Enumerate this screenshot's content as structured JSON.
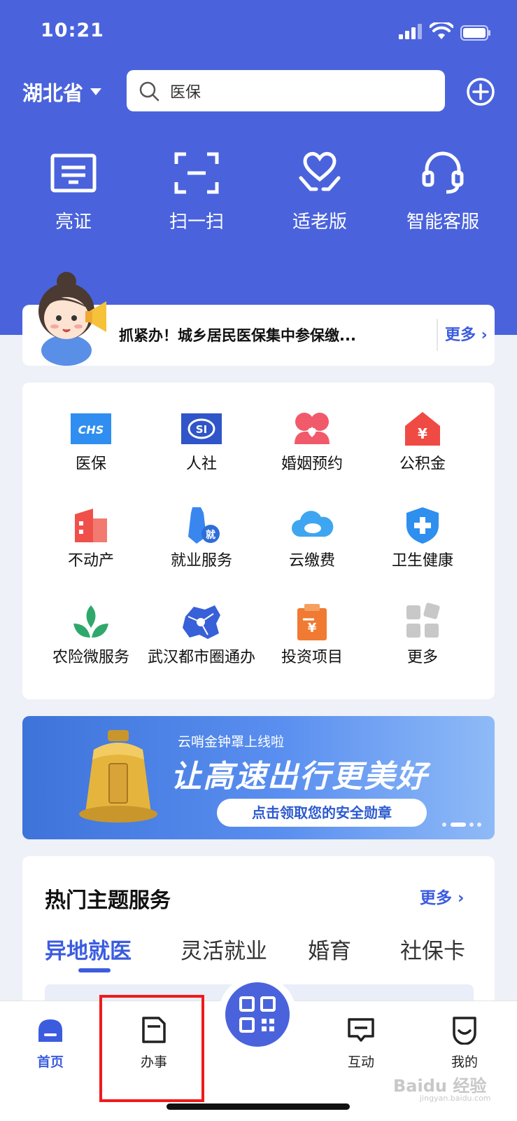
{
  "status_bar": {
    "time": "10:21"
  },
  "header": {
    "region": "湖北省",
    "search_placeholder": "医保"
  },
  "quick_actions": [
    {
      "label": "亮证",
      "icon": "id-card-icon"
    },
    {
      "label": "扫一扫",
      "icon": "scan-frame-icon"
    },
    {
      "label": "适老版",
      "icon": "heart-hands-icon"
    },
    {
      "label": "智能客服",
      "icon": "headset-icon"
    }
  ],
  "notice": {
    "text": "抓紧办！城乡居民医保集中参保缴...",
    "more": "更多 ›"
  },
  "services": [
    {
      "label": "医保",
      "icon": "chs-logo-icon",
      "color": "#2f8ef0"
    },
    {
      "label": "人社",
      "icon": "si-logo-icon",
      "color": "#2f55c8"
    },
    {
      "label": "婚姻预约",
      "icon": "couple-heart-icon",
      "color": "#f05a6a"
    },
    {
      "label": "公积金",
      "icon": "house-yuan-icon",
      "color": "#f04a45"
    },
    {
      "label": "不动产",
      "icon": "building-icon",
      "color": "#f0504a"
    },
    {
      "label": "就业服务",
      "icon": "tie-icon",
      "color": "#3a86ef"
    },
    {
      "label": "云缴费",
      "icon": "cloud-icon",
      "color": "#3ea6f0"
    },
    {
      "label": "卫生健康",
      "icon": "shield-cross-icon",
      "color": "#2e8fef"
    },
    {
      "label": "农险微服务",
      "icon": "sprout-icon",
      "color": "#2fa96b"
    },
    {
      "label": "武汉都市圈通办",
      "icon": "map-icon",
      "color": "#3860d8"
    },
    {
      "label": "投资项目",
      "icon": "clipboard-yuan-icon",
      "color": "#f07a32"
    },
    {
      "label": "更多",
      "icon": "grid-more-icon",
      "color": "#c8c8c8"
    }
  ],
  "banner": {
    "small_text": "云哨金钟罩上线啦",
    "big_text": "让高速出行更美好",
    "cta": "点击领取您的安全勋章"
  },
  "hot_topics": {
    "title": "热门主题服务",
    "more": "更多 ›",
    "tabs": [
      "异地就医",
      "灵活就业",
      "婚育",
      "社保卡"
    ],
    "active_tab": 0
  },
  "nav": [
    {
      "label": "首页",
      "icon": "home-icon",
      "active": true
    },
    {
      "label": "办事",
      "icon": "document-icon",
      "active": false
    },
    {
      "label": "互动",
      "icon": "chat-icon",
      "active": false
    },
    {
      "label": "我的",
      "icon": "smile-face-icon",
      "active": false
    }
  ],
  "watermark": {
    "text": "Baidu 经验",
    "sub": "jingyan.baidu.com"
  },
  "colors": {
    "primary": "#4a63dc",
    "accent": "#3c5ce0",
    "highlight": "#f01a1a"
  }
}
